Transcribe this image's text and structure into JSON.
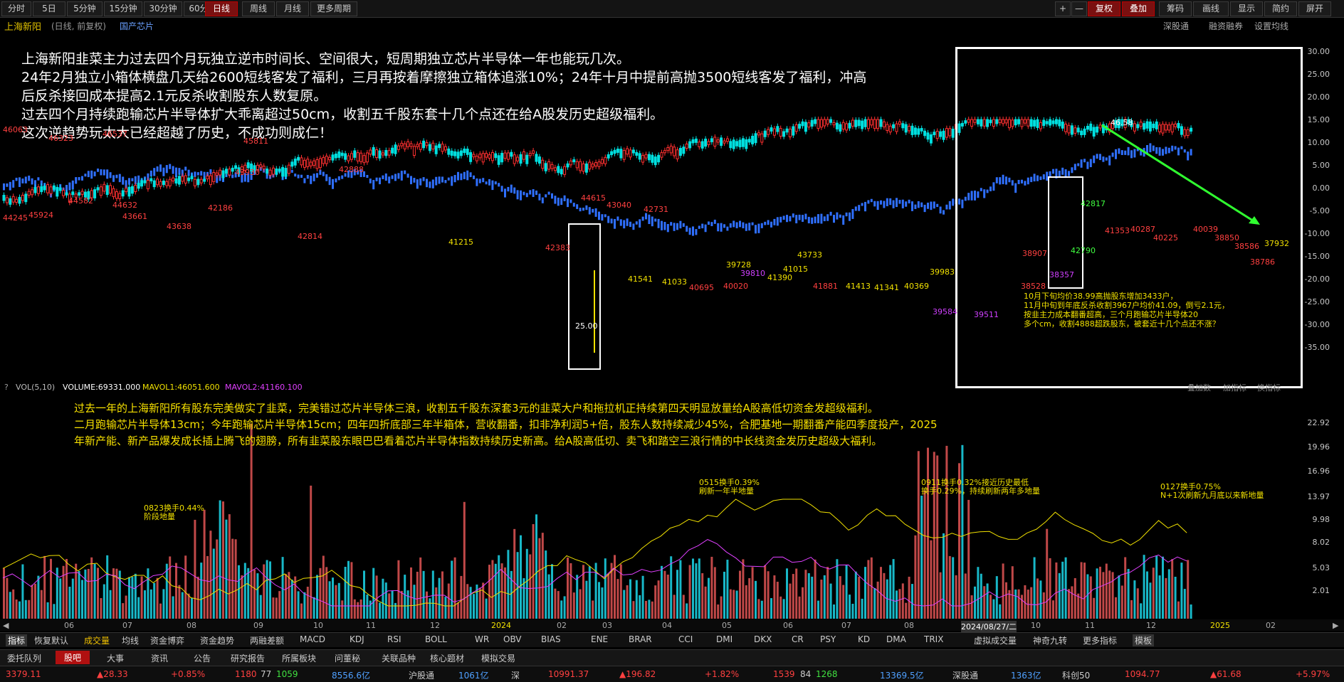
{
  "toolbar": {
    "periods": [
      "分时",
      "5日",
      "5分钟",
      "15分钟",
      "30分钟",
      "60分钟",
      "日线",
      "周线",
      "月线",
      "更多周期"
    ],
    "active_period": "日线",
    "right_buttons": [
      "+",
      "—",
      "复权",
      "叠加",
      "筹码",
      "画线",
      "显示",
      "简约",
      "屏开"
    ]
  },
  "title": {
    "stock_name": "上海新阳",
    "sub": "(日线, 前复权)",
    "concept": "国产芯片",
    "right_links": [
      "深股通",
      "融资融券",
      "设置均线"
    ]
  },
  "annotations": {
    "main_lines": [
      "上海新阳韭菜主力过去四个月玩独立逆市时间长、空间很大，短周期独立芯片半导体一年也能玩几次。",
      "24年2月独立小箱体横盘几天给2600短线客发了福利，三月再按着摩擦独立箱体追涨10%；24年十月中提前高抛3500短线客发了福利，冲高",
      "后反杀接回成本提高2.1元反杀收割股东人数复原。",
      "过去四个月持续跑输芯片半导体扩大乖离超过50cm，收割五千股东套十几个点还在给A股发历史超级福利。",
      "这次逆趋势玩太大已经超越了历史，不成功则成仁！"
    ],
    "vol_lines": [
      "过去一年的上海新阳所有股东完美做实了韭菜，完美错过芯片半导体三浪，收割五千股东深套3元的韭菜大户和拖拉机正持续第四天明显放量给A股高低切资金发超级福利。",
      "二月跑输芯片半导体13cm；今年跑输芯片半导体15cm；四年四折底部三年半箱体，营收翻番，扣非净利润5+倍，股东人数持续减少45%，合肥基地一期翻番产能四季度投产，2025",
      "年新产能、新产品爆发成长插上腾飞的翅膀，所有韭菜股东眼巴巴看着芯片半导体指数持续历史新高。给A股高低切、卖飞和踏空三浪行情的中长线资金发历史超级大福利。"
    ],
    "vol_notes": [
      {
        "line1": "0823换手0.44%",
        "line2": "阶段地量"
      },
      {
        "line1": "0515换手0.39%",
        "line2": "刷新一年半地量"
      },
      {
        "line1": "0911换手0.32%接近历史最低",
        "line2": "换手0.29%，持续刷新两年多地量"
      },
      {
        "line1": "0127换手0.75%",
        "line2": "N+1次刷新九月底以来新地量"
      }
    ],
    "inset_notes": [
      "10月下旬均价38.99高抛股东增加3433户，",
      "11月中旬到年底反杀收割3967户均价41.09，倒亏2.1元，",
      "按韭主力成本翻番超高，三个月跑输芯片半导体20",
      "多个cm，收割4888超跌股东，被套近十几个点还不涨？"
    ],
    "inset_label": "46.58"
  },
  "price_labels": [
    {
      "t": "46063",
      "c": "#ff4040"
    },
    {
      "t": "46323",
      "c": "#ff4040"
    },
    {
      "t": "46537",
      "c": "#ff4040"
    },
    {
      "t": "44245",
      "c": "#ff4040"
    },
    {
      "t": "45924",
      "c": "#ff4040"
    },
    {
      "t": "44582",
      "c": "#ff4040"
    },
    {
      "t": "44632",
      "c": "#ff4040"
    },
    {
      "t": "43661",
      "c": "#ff4040"
    },
    {
      "t": "43638",
      "c": "#ff4040"
    },
    {
      "t": "42186",
      "c": "#ff4040"
    },
    {
      "t": "45811",
      "c": "#ff4040"
    },
    {
      "t": "43930",
      "c": "#ff4040"
    },
    {
      "t": "42814",
      "c": "#ff4040"
    },
    {
      "t": "42888",
      "c": "#ff4040"
    },
    {
      "t": "41215",
      "c": "#f0e000"
    },
    {
      "t": "42383",
      "c": "#ff4040"
    },
    {
      "t": "44615",
      "c": "#ff4040"
    },
    {
      "t": "43040",
      "c": "#ff4040"
    },
    {
      "t": "42731",
      "c": "#ff4040"
    },
    {
      "t": "41541",
      "c": "#f0e000"
    },
    {
      "t": "41033",
      "c": "#f0e000"
    },
    {
      "t": "40695",
      "c": "#ff4040"
    },
    {
      "t": "40020",
      "c": "#ff4040"
    },
    {
      "t": "39728",
      "c": "#f0e000"
    },
    {
      "t": "39810",
      "c": "#d040ff"
    },
    {
      "t": "41390",
      "c": "#f0e000"
    },
    {
      "t": "41015",
      "c": "#f0e000"
    },
    {
      "t": "43733",
      "c": "#f0e000"
    },
    {
      "t": "41881",
      "c": "#ff4040"
    },
    {
      "t": "41413",
      "c": "#f0e000"
    },
    {
      "t": "41341",
      "c": "#f0e000"
    },
    {
      "t": "40369",
      "c": "#f0e000"
    },
    {
      "t": "39983",
      "c": "#f0e000"
    },
    {
      "t": "39584",
      "c": "#d040ff"
    },
    {
      "t": "39511",
      "c": "#d040ff"
    },
    {
      "t": "38528",
      "c": "#ff4040"
    },
    {
      "t": "38907",
      "c": "#ff4040"
    },
    {
      "t": "38357",
      "c": "#d040ff"
    },
    {
      "t": "42817",
      "c": "#40ff40"
    },
    {
      "t": "42790",
      "c": "#40ff40"
    },
    {
      "t": "41353",
      "c": "#ff4040"
    },
    {
      "t": "40287",
      "c": "#ff4040"
    },
    {
      "t": "40225",
      "c": "#ff4040"
    },
    {
      "t": "40039",
      "c": "#ff4040"
    },
    {
      "t": "38850",
      "c": "#ff4040"
    },
    {
      "t": "38586",
      "c": "#ff4040"
    },
    {
      "t": "38786",
      "c": "#ff4040"
    },
    {
      "t": "37932",
      "c": "#f0e000"
    },
    {
      "t": "25.00",
      "c": "#ffffff"
    }
  ],
  "right_axis_main": [
    "30.00",
    "25.00",
    "20.00",
    "15.00",
    "10.00",
    "5.00",
    "0.00",
    "-5.00",
    "-10.00",
    "-15.00",
    "-20.00",
    "-25.00",
    "-30.00",
    "-35.00"
  ],
  "right_axis_vol": [
    "22.92",
    "19.96",
    "16.96",
    "13.97",
    "9.98",
    "8.02",
    "5.03",
    "2.01"
  ],
  "vol_header": {
    "label": "VOL(5,10)",
    "volume": "VOLUME:69331.000",
    "mavol1": "MAVOL1:46051.600",
    "mavol2": "MAVOL2:41160.100"
  },
  "inset_buttons": [
    "叠加数",
    "加指标",
    "换指标"
  ],
  "date_axis": [
    "06",
    "07",
    "08",
    "09",
    "10",
    "11",
    "12",
    "2024",
    "02",
    "03",
    "04",
    "05",
    "06",
    "07",
    "08",
    "2024/08/27/二",
    "10",
    "11",
    "12",
    "2025",
    "02"
  ],
  "indicators": [
    "指标",
    "恢复默认",
    "成交量",
    "均线",
    "资金博弈",
    "资金趋势",
    "两融差额",
    "MACD",
    "KDJ",
    "RSI",
    "BOLL",
    "WR",
    "OBV",
    "BIAS",
    "ENE",
    "BRAR",
    "CCI",
    "DMI",
    "DKX",
    "CR",
    "PSY",
    "KD",
    "DMA",
    "TRIX",
    "虚拟成交量",
    "神奇九转",
    "更多指标",
    "模板"
  ],
  "bottom_tabs": [
    "委托队列",
    "股吧",
    "大事",
    "资讯",
    "公告",
    "研究报告",
    "所属板块",
    "问董秘",
    "关联品种",
    "核心题材",
    "模拟交易"
  ],
  "active_tab": "股吧",
  "status": {
    "v1": "3379.11",
    "v2": "▲28.33",
    "v3": "+0.85%",
    "v4": "1180",
    "v5": "77",
    "v6": "1059",
    "v7": "8556.6亿",
    "sh_label": "沪股通",
    "sh_val": "1061亿",
    "sz_label": "深",
    "s1": "10991.37",
    "s2": "▲196.82",
    "s3": "+1.82%",
    "s4": "1539",
    "s5": "84",
    "s6": "1268",
    "s7": "13369.5亿",
    "szt_label": "深股通",
    "szt_val": "1363亿",
    "kc_label": "科创50",
    "kc1": "1094.77",
    "kc2": "▲61.68",
    "kc3": "+5.97%"
  },
  "colors": {
    "up": "#ff3030",
    "down": "#2aa8ff",
    "cyan": "#00e0e0",
    "blue": "#2f6fff",
    "yellow": "#f0e000",
    "magenta": "#e040ff",
    "green": "#30ff30"
  }
}
